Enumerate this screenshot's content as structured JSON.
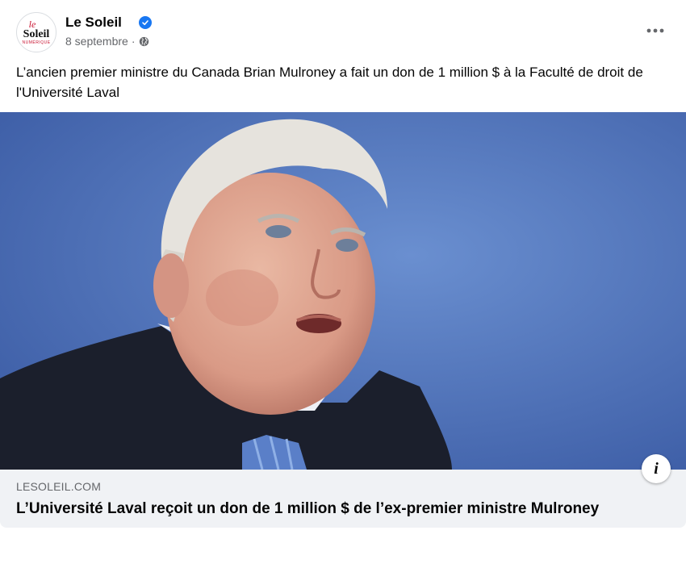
{
  "post": {
    "page_name": "Le Soleil",
    "verified_icon": "verified-badge-icon",
    "date": "8 septembre",
    "separator": "·",
    "audience_icon": "globe-icon",
    "more_icon": "more-options-icon",
    "text": "L’ancien premier ministre du Canada Brian Mulroney a fait un don de 1 million $ à la Faculté de droit de l'Université Laval"
  },
  "avatar": {
    "line1": "le",
    "line2": "Soleil",
    "line3": "NUMÉRIQUE"
  },
  "link": {
    "domain": "LESOLEIL.COM",
    "headline": "L’Université Laval reçoit un don de 1 million $ de l’ex-premier ministre Mulroney",
    "info_icon": "info-icon",
    "info_label": "i"
  },
  "colors": {
    "brand_red": "#c8102e",
    "verified_blue": "#1877f2",
    "footer_bg": "#f0f2f5"
  }
}
